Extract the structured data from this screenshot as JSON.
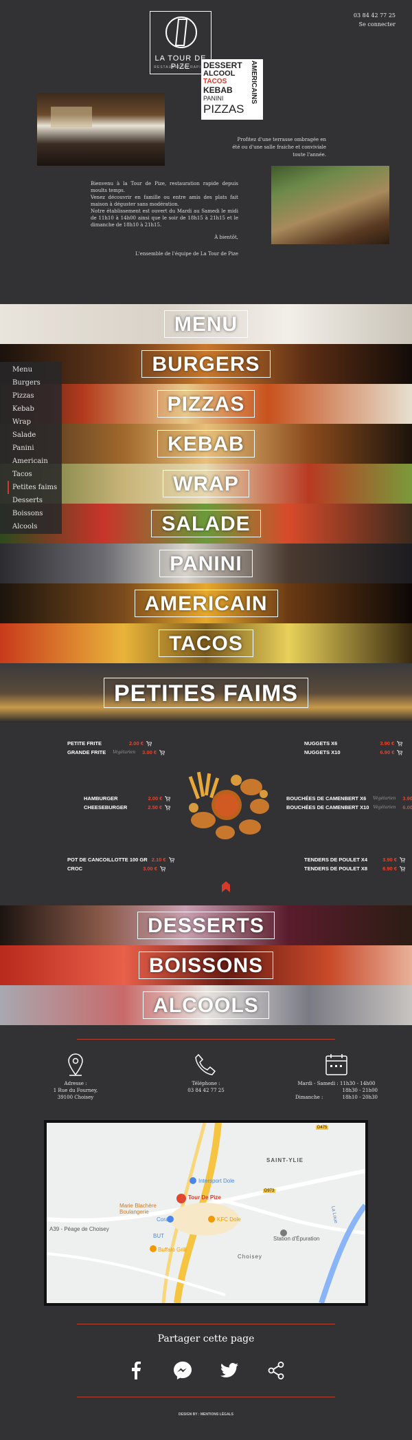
{
  "header": {
    "phone": "03 84 42 77 25",
    "login": "Se connecter",
    "logo_title": "LA TOUR DE PIZE",
    "logo_sub": "RESTAURATION RAPIDE",
    "wordcloud": [
      "DESSERT",
      "ALCOOL",
      "TACOS",
      "KEBAB",
      "PANINI",
      "PIZZAS"
    ],
    "wordcloud_side": "AMERICAINS"
  },
  "intro": {
    "terrace": "Profitez d'une terrasse ombragée en été ou d'une salle fraiche et conviviale toute l'année.",
    "p1": "Bienvenu à la Tour de Pize, restauration rapide depuis moults temps.",
    "p2": "Venez découvrir en famille ou entre amis des plats fait maison à déguster sans modération.",
    "p3": "Notre établissement est ouvert du Mardi au Samedi le midi de 11h10 à 14h00 ainsi que le soir de 18h15 à 21h15 et le dimanche de 18h10 à 21h15.",
    "bientot": "À bientôt,",
    "sign": "L'ensemble de l'équipe de La Tour de Pize"
  },
  "categories": [
    "MENU",
    "BURGERS",
    "PIZZAS",
    "KEBAB",
    "WRAP",
    "SALADE",
    "PANINI",
    "AMERICAIN",
    "TACOS",
    "PETITES FAIMS"
  ],
  "categories_bottom": [
    "DESSERTS",
    "BOISSONS",
    "ALCOOLS"
  ],
  "side_menu": [
    "Menu",
    "Burgers",
    "Pizzas",
    "Kebab",
    "Wrap",
    "Salade",
    "Panini",
    "Americain",
    "Tacos",
    "Petites faims",
    "Desserts",
    "Boissons",
    "Alcools"
  ],
  "petites_faims": {
    "veg": "Végétarien",
    "left": [
      {
        "name": "PETITE FRITE",
        "price": "2.00 €",
        "veg": false
      },
      {
        "name": "GRANDE FRITE",
        "price": "3.00 €",
        "veg": true
      },
      {
        "name": "HAMBURGER",
        "price": "2.00 €",
        "veg": false
      },
      {
        "name": "CHEESEBURGER",
        "price": "2.50 €",
        "veg": false
      },
      {
        "name": "POT DE CANCOILLOTTE 100 GR",
        "price": "2.10 €",
        "veg": false
      },
      {
        "name": "CROC",
        "price": "3.00 €",
        "veg": false
      }
    ],
    "right": [
      {
        "name": "NUGGETS X6",
        "price": "3.90 €",
        "veg": false
      },
      {
        "name": "NUGGETS X10",
        "price": "6.90 €",
        "veg": false
      },
      {
        "name": "BOUCHÉES DE CAMENBERT X6",
        "price": "3.90 €",
        "veg": true
      },
      {
        "name": "BOUCHÉES DE CAMENBERT X10",
        "price": "6.00 €",
        "veg": true
      },
      {
        "name": "TENDERS DE POULET X4",
        "price": "3.90 €",
        "veg": false
      },
      {
        "name": "TENDERS DE POULET X8",
        "price": "6.90 €",
        "veg": false
      }
    ]
  },
  "contact": {
    "address_label": "Adresse :",
    "address_1": "1 Rue du Fourney,",
    "address_2": "39100 Choisey",
    "phone_label": "Téléphone :",
    "phone": "03 84 42 77 25",
    "hours_1_day": "Mardi - Samedi : 11h30 - 14h00",
    "hours_2": "18h30 - 21h00",
    "hours_3_day": "Dimanche :",
    "hours_3": "18h10 - 20h30"
  },
  "map": {
    "place": "Tour De Pize",
    "labels": [
      "SAINT-YLIE",
      "Intersport Dole",
      "Marie Blachère Boulangerie",
      "KFC Dole",
      "Cora",
      "BUT",
      "Station d'Épuration",
      "Buffalo Grill",
      "A39 - Péage de Choisey",
      "Choisey",
      "D475",
      "D973",
      "La Loue"
    ]
  },
  "share": {
    "title": "Partager cette page"
  },
  "footer": {
    "text": "DESIGN BY : MENTIONS LÉGALS"
  },
  "colors": {
    "background": "#323234",
    "accent": "#e24631",
    "rule": "#b8422e"
  }
}
